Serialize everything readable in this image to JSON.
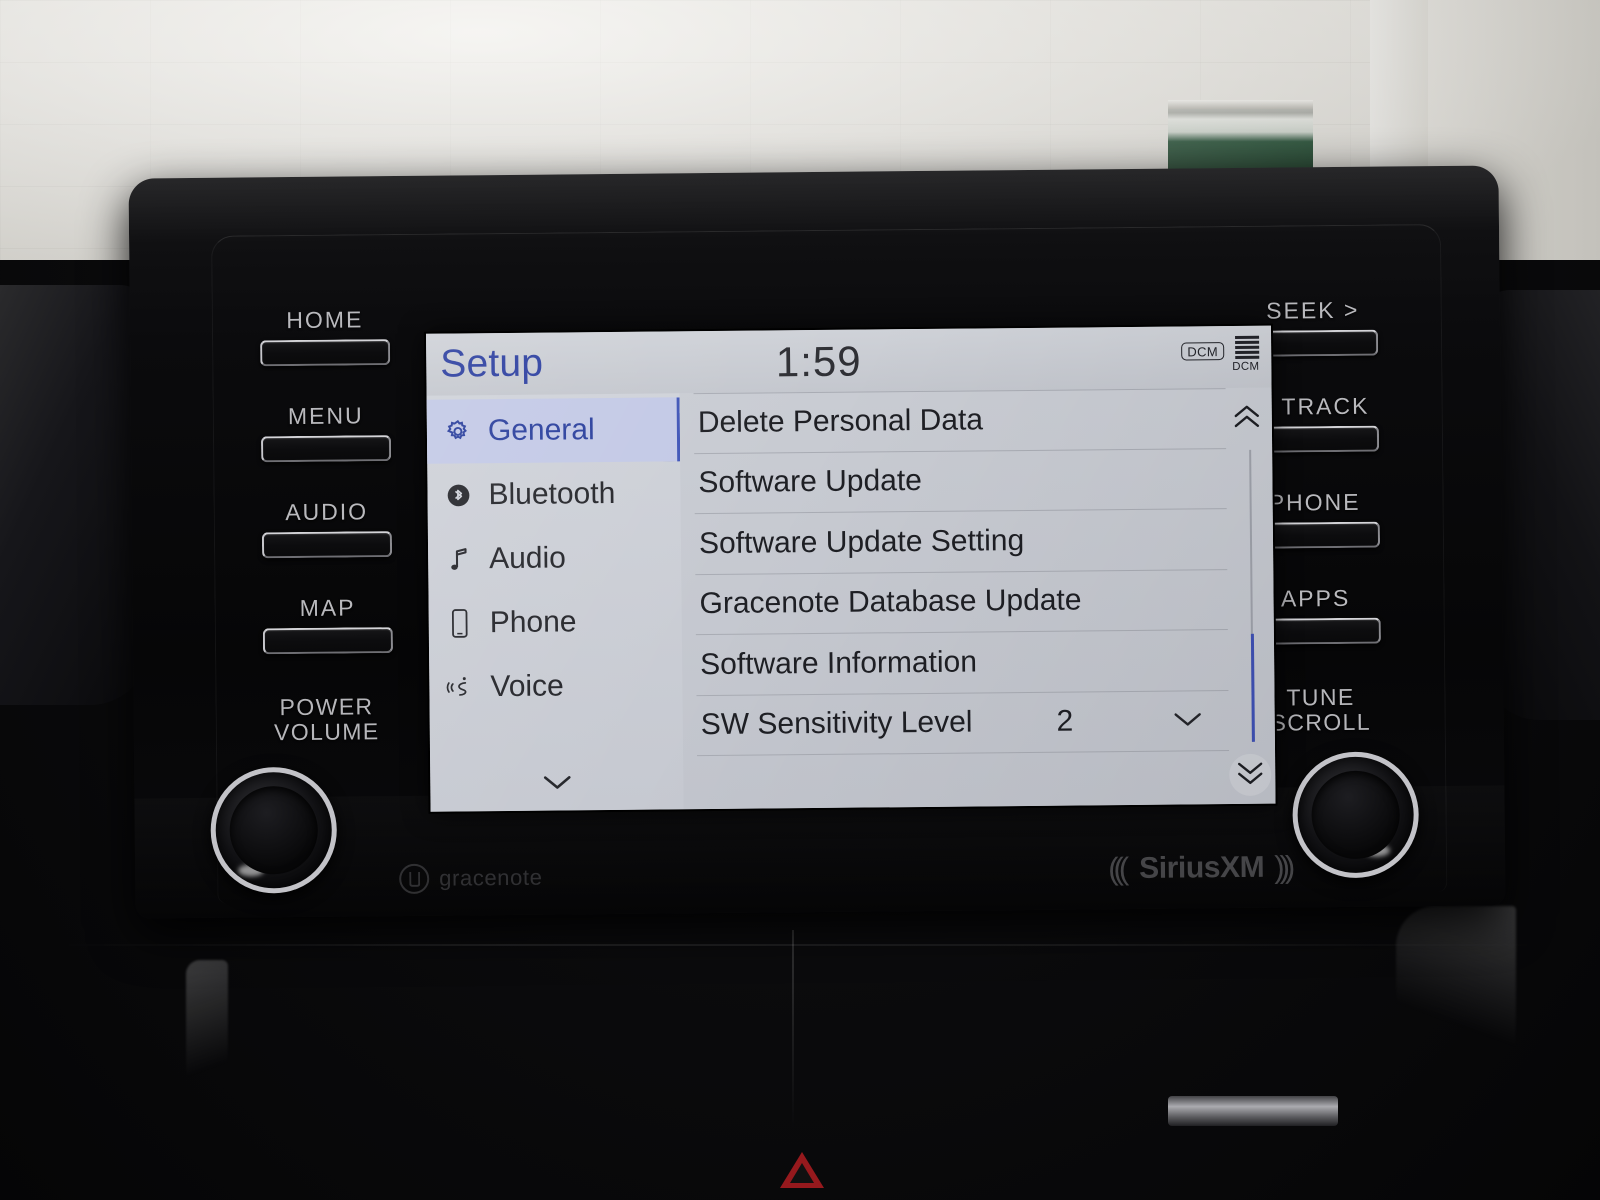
{
  "screen": {
    "title": "Setup",
    "clock": "1:59",
    "status_icons": [
      {
        "name": "dcm-badge",
        "label": "DCM"
      },
      {
        "name": "dcm-signal",
        "label": "DCM"
      }
    ],
    "sidebar": {
      "items": [
        {
          "label": "General",
          "icon": "gear-icon",
          "selected": true
        },
        {
          "label": "Bluetooth",
          "icon": "bluetooth-icon",
          "selected": false
        },
        {
          "label": "Audio",
          "icon": "music-note-icon",
          "selected": false
        },
        {
          "label": "Phone",
          "icon": "phone-icon",
          "selected": false
        },
        {
          "label": "Voice",
          "icon": "voice-icon",
          "selected": false
        }
      ],
      "more_icon": "chevron-down-icon"
    },
    "list": {
      "rows": [
        {
          "label": "Delete Personal Data",
          "value": ""
        },
        {
          "label": "Software Update",
          "value": ""
        },
        {
          "label": "Software Update Setting",
          "value": ""
        },
        {
          "label": "Gracenote Database Update",
          "value": ""
        },
        {
          "label": "Software Information",
          "value": ""
        },
        {
          "label": "SW Sensitivity Level",
          "value": "2"
        }
      ]
    },
    "scroll": {
      "up_icon": "double-chevron-up-icon",
      "down_icon": "double-chevron-down-icon"
    },
    "colors": {
      "title_blue": "#2c3fa0",
      "selection_bg": "#c3c9e6",
      "selection_text": "#2a3f9d",
      "screen_bg": "#c9ccd3",
      "scroll_thumb": "#3f51b5"
    }
  },
  "hard_buttons": {
    "left": [
      "HOME",
      "MENU",
      "AUDIO",
      "MAP"
    ],
    "right": [
      "SEEK >",
      "< TRACK",
      "PHONE",
      "APPS"
    ]
  },
  "knobs": {
    "left": {
      "line1": "POWER",
      "line2": "VOLUME"
    },
    "right": {
      "line1": "TUNE",
      "line2": "SCROLL"
    }
  },
  "branding": {
    "gracenote": "gracenote",
    "siriusxm": "SiriusXM",
    "siriusxm_wave_left": ")))",
    "siriusxm_wave_right": ")))"
  }
}
